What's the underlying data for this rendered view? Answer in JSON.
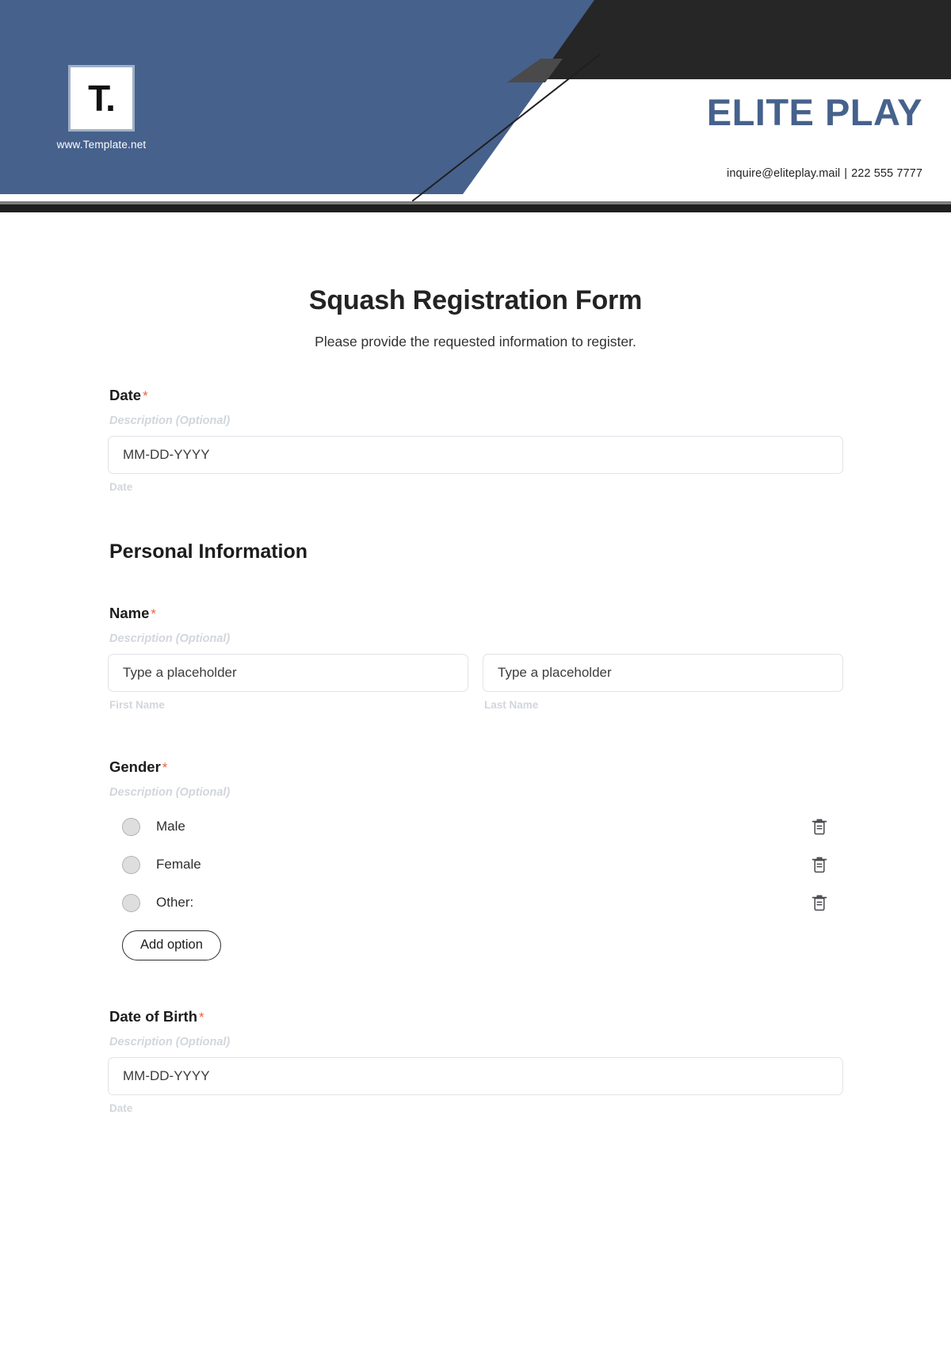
{
  "header": {
    "logo_mark": "T.",
    "logo_url": "www.Template.net",
    "brand_name": "ELITE PLAY",
    "contact_email": "inquire@eliteplay.mail",
    "contact_separator": "|",
    "contact_phone": "222 555 7777",
    "colors": {
      "blue": "#46618c",
      "black": "#262626",
      "accent_required": "#f2603c"
    }
  },
  "form": {
    "title": "Squash Registration Form",
    "subtitle": "Please provide the requested information to register.",
    "description_placeholder": "Description (Optional)",
    "fields": {
      "date": {
        "label": "Date",
        "required_mark": "*",
        "description": "Description (Optional)",
        "input_value": "MM-DD-YYYY",
        "helper": "Date"
      },
      "section_personal": {
        "heading": "Personal Information"
      },
      "name": {
        "label": "Name",
        "required_mark": "*",
        "description": "Description (Optional)",
        "first": {
          "input_value": "Type a placeholder",
          "helper": "First Name"
        },
        "last": {
          "input_value": "Type a placeholder",
          "helper": "Last Name"
        }
      },
      "gender": {
        "label": "Gender",
        "required_mark": "*",
        "description": "Description (Optional)",
        "options": [
          {
            "label": "Male",
            "delete_icon": "trash-icon"
          },
          {
            "label": "Female",
            "delete_icon": "trash-icon"
          },
          {
            "label": "Other:",
            "delete_icon": "trash-icon"
          }
        ],
        "add_option_label": "Add option"
      },
      "dob": {
        "label": "Date of Birth",
        "required_mark": "*",
        "description": "Description (Optional)",
        "input_value": "MM-DD-YYYY",
        "helper": "Date"
      }
    }
  }
}
